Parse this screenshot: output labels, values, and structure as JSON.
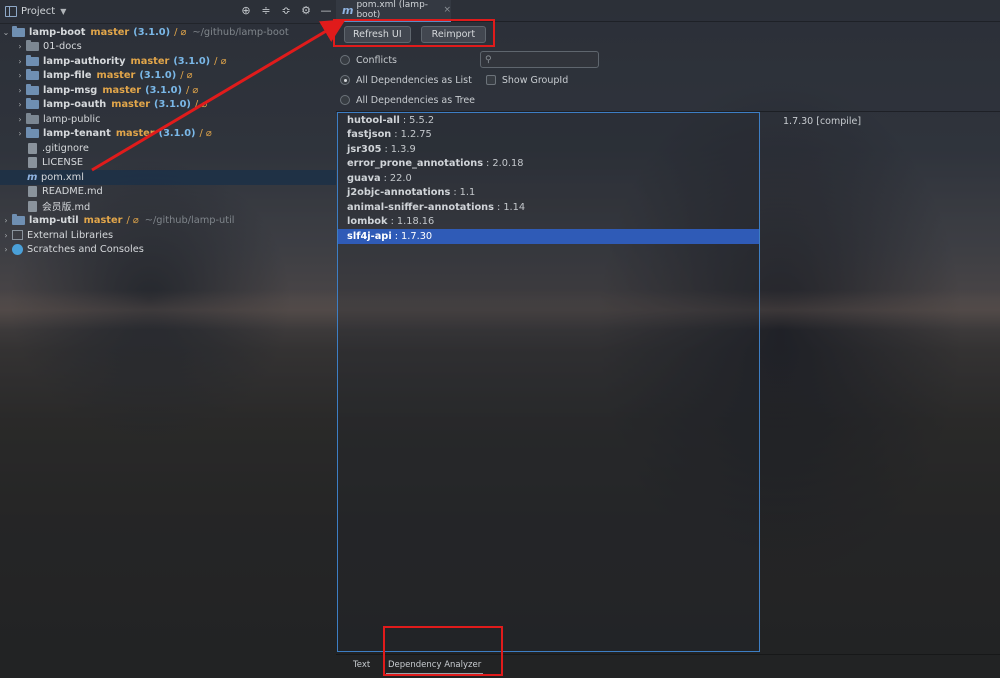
{
  "project_panel": {
    "title": "Project",
    "tree": [
      {
        "name": "lamp-boot",
        "branch": "master",
        "version": "(3.1.0)",
        "status": "/ ⌀",
        "path": "~/github/lamp-boot"
      },
      {
        "name": "01-docs"
      },
      {
        "name": "lamp-authority",
        "branch": "master",
        "version": "(3.1.0)",
        "status": "/ ⌀"
      },
      {
        "name": "lamp-file",
        "branch": "master",
        "version": "(3.1.0)",
        "status": "/ ⌀"
      },
      {
        "name": "lamp-msg",
        "branch": "master",
        "version": "(3.1.0)",
        "status": "/ ⌀"
      },
      {
        "name": "lamp-oauth",
        "branch": "master",
        "version": "(3.1.0)",
        "status": "/ ⌀"
      },
      {
        "name": "lamp-public"
      },
      {
        "name": "lamp-tenant",
        "branch": "master",
        "version": "(3.1.0)",
        "status": "/ ⌀"
      },
      {
        "name": ".gitignore"
      },
      {
        "name": "LICENSE"
      },
      {
        "name": "pom.xml"
      },
      {
        "name": "README.md"
      },
      {
        "name": "会员版.md"
      },
      {
        "name": "lamp-util",
        "branch": "master",
        "status": "/ ⌀",
        "path": "~/github/lamp-util"
      },
      {
        "name": "External Libraries"
      },
      {
        "name": "Scratches and Consoles"
      }
    ]
  },
  "editor": {
    "tab_label": "pom.xml (lamp-boot)",
    "refresh_label": "Refresh UI",
    "reimport_label": "Reimport",
    "conflicts_label": "Conflicts",
    "search_placeholder": "",
    "list_label": "All Dependencies as List",
    "groupid_label": "Show GroupId",
    "tree_label": "All Dependencies as Tree",
    "dependencies": [
      {
        "name": "hutool-all",
        "version": "5.5.2"
      },
      {
        "name": "fastjson",
        "version": "1.2.75"
      },
      {
        "name": "jsr305",
        "version": "1.3.9"
      },
      {
        "name": "error_prone_annotations",
        "version": "2.0.18"
      },
      {
        "name": "guava",
        "version": "22.0"
      },
      {
        "name": "j2objc-annotations",
        "version": "1.1"
      },
      {
        "name": "animal-sniffer-annotations",
        "version": "1.14"
      },
      {
        "name": "lombok",
        "version": "1.18.16"
      },
      {
        "name": "slf4j-api",
        "version": "1.7.30"
      }
    ],
    "detail_text": "1.7.30 [compile]",
    "bottom_tabs": {
      "text": "Text",
      "analyzer": "Dependency Analyzer"
    }
  },
  "colors": {
    "accent": "#2f5bb7",
    "annotation": "#e01b1b",
    "branch": "#e2a64a",
    "version": "#7ab8e8"
  }
}
